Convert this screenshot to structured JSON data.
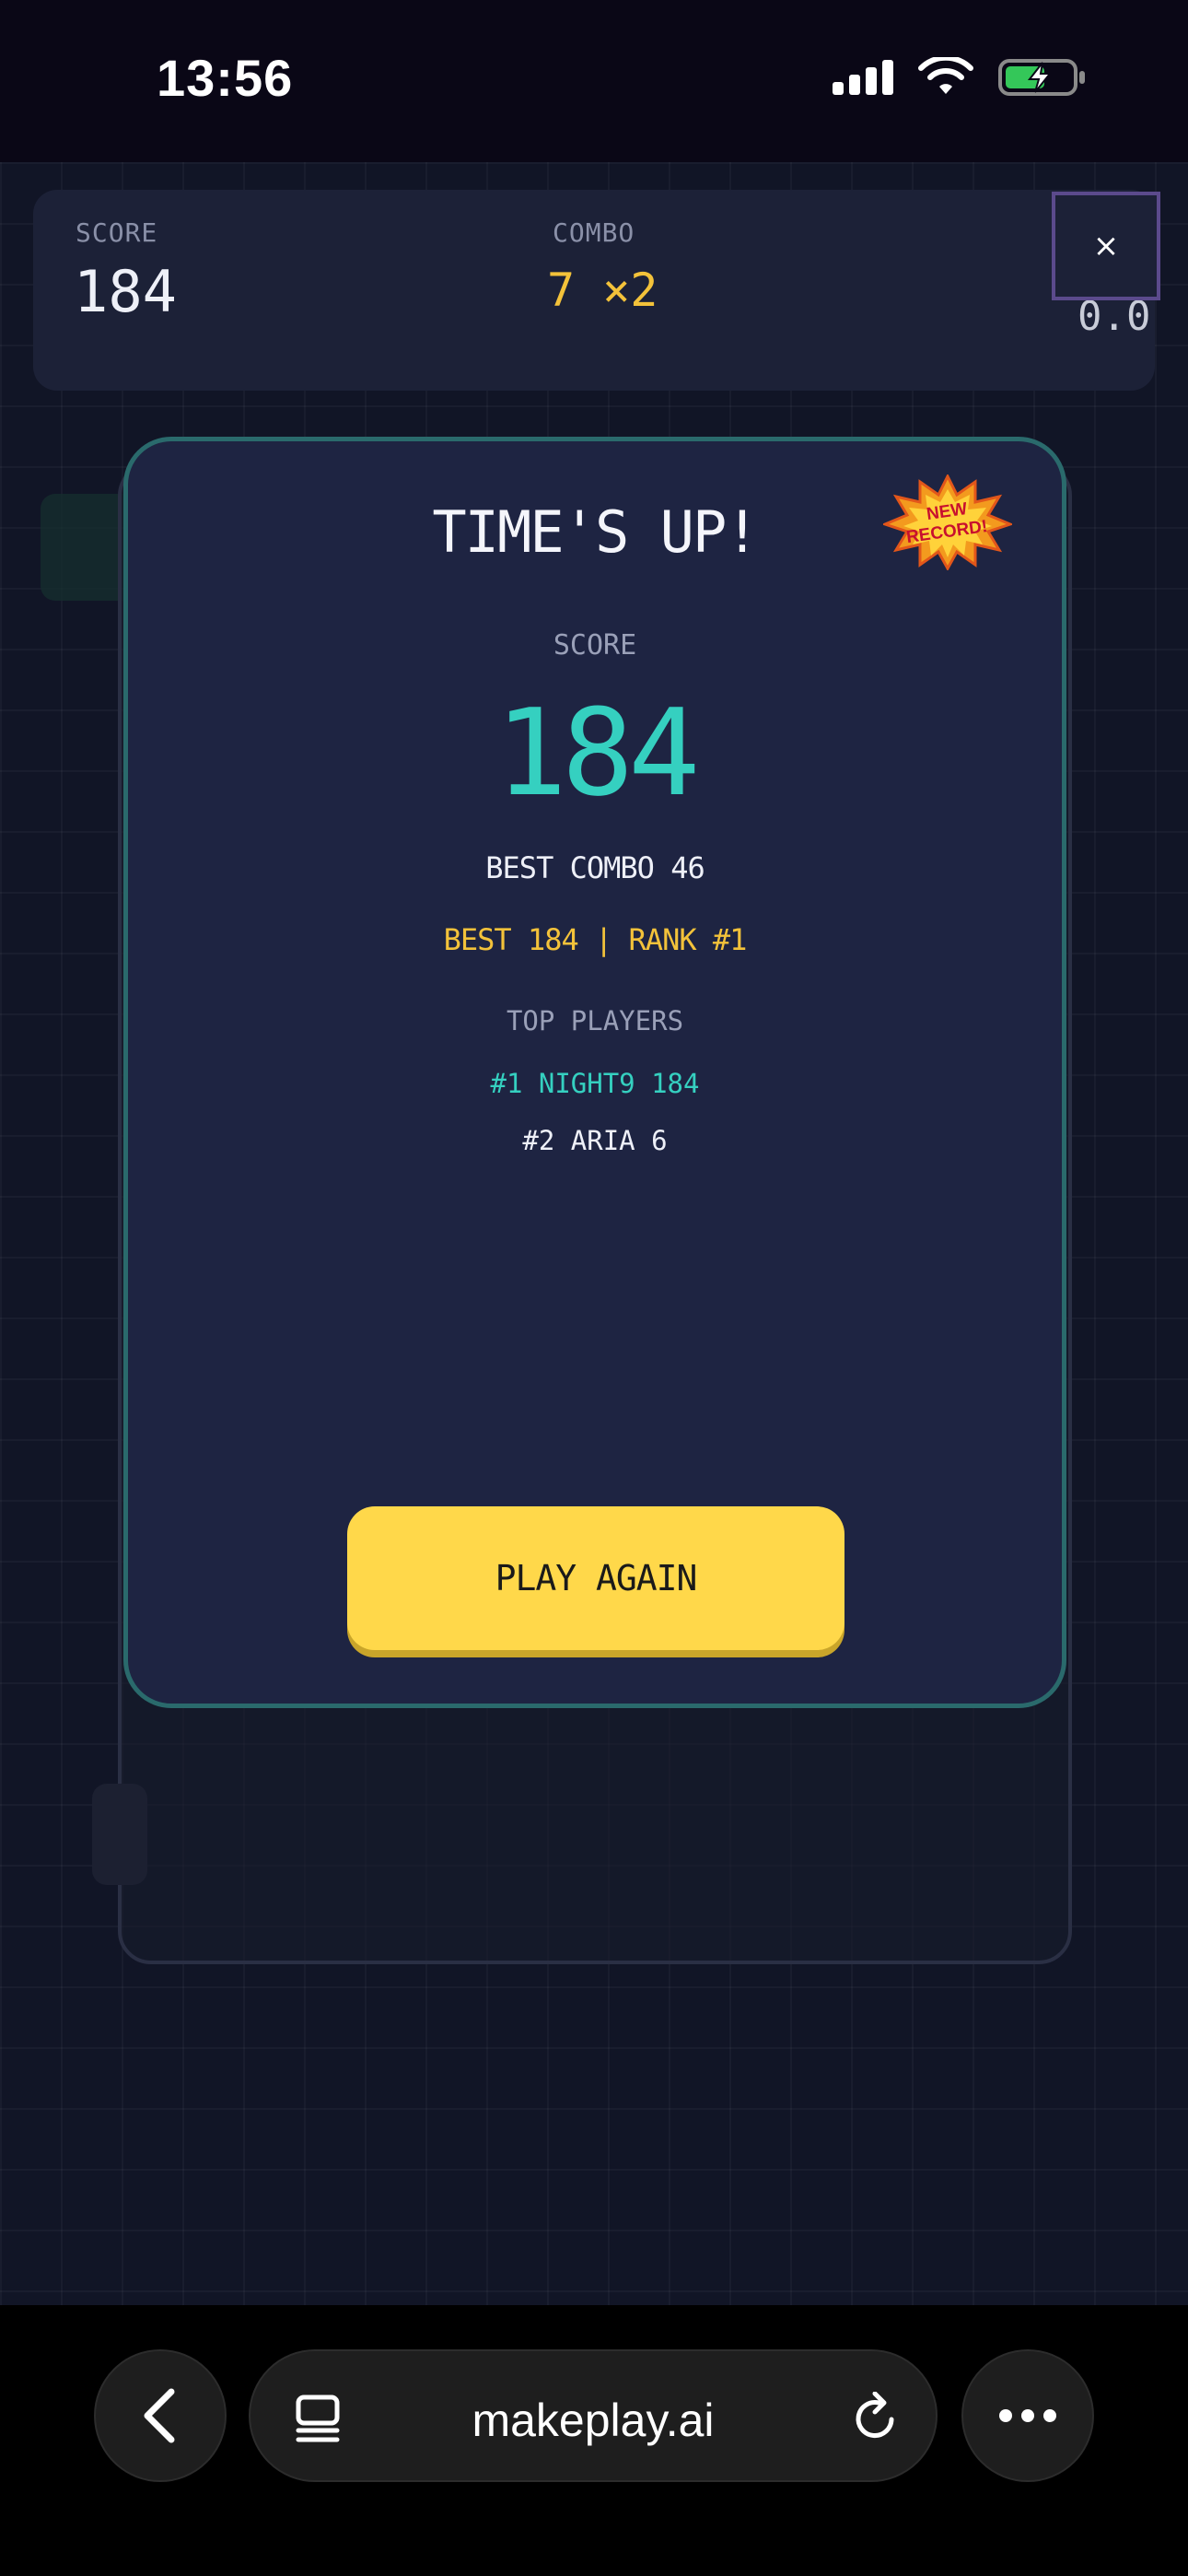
{
  "status_bar": {
    "time": "13:56"
  },
  "hud": {
    "score_label": "SCORE",
    "score_value": "184",
    "combo_label": "COMBO",
    "combo_value": "7 ×2",
    "partial_value": "0.0",
    "close_label": "×"
  },
  "modal": {
    "title": "TIME'S UP!",
    "badge_text": "NEW RECORD!",
    "score_label": "SCORE",
    "score_value": "184",
    "best_combo": "BEST COMBO 46",
    "best_rank": "BEST 184 | RANK #1",
    "top_players_label": "TOP PLAYERS",
    "players": [
      "#1 NIGHT9 184",
      "#2 ARIA 6"
    ],
    "play_again_label": "PLAY AGAIN"
  },
  "browser": {
    "url": "makeplay.ai"
  },
  "colors": {
    "accent_teal": "#35d0c0",
    "accent_gold": "#f3c23a",
    "button_yellow": "#ffd84a",
    "modal_bg": "#1e2442"
  }
}
